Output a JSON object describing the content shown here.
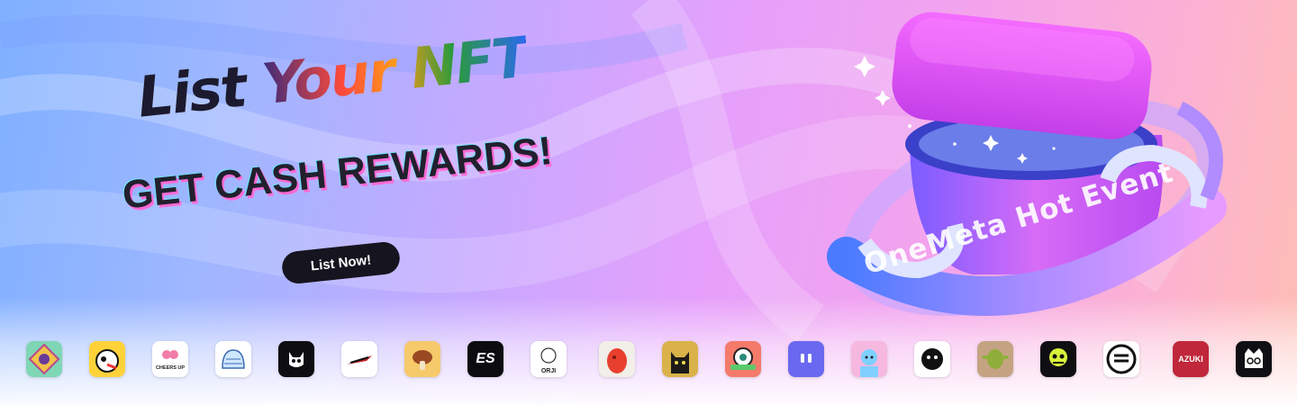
{
  "hero": {
    "title_part1": "List",
    "title_part2": "Your NFT",
    "subtitle": "GET CASH REWARDS!",
    "cta_label": "List Now!",
    "event_ribbon": "OneMeta Hot Event"
  },
  "logos": [
    {
      "name": "nft-logo-1"
    },
    {
      "name": "nft-logo-2"
    },
    {
      "name": "nft-logo-cheers-up",
      "text": "CHEERS UP"
    },
    {
      "name": "nft-logo-4"
    },
    {
      "name": "nft-logo-5"
    },
    {
      "name": "nft-logo-6"
    },
    {
      "name": "nft-logo-7"
    },
    {
      "name": "nft-logo-es",
      "text": "ES"
    },
    {
      "name": "nft-logo-orji",
      "text": "ORJI"
    },
    {
      "name": "nft-logo-10"
    },
    {
      "name": "nft-logo-11"
    },
    {
      "name": "nft-logo-12"
    },
    {
      "name": "nft-logo-13"
    },
    {
      "name": "nft-logo-14"
    },
    {
      "name": "nft-logo-15"
    },
    {
      "name": "nft-logo-16"
    },
    {
      "name": "nft-logo-17"
    },
    {
      "name": "nft-logo-18"
    },
    {
      "name": "nft-logo-azuki",
      "text": "AZUKI"
    },
    {
      "name": "nft-logo-20"
    }
  ],
  "colors": {
    "cta_bg": "#16141f",
    "box_magenta": "#e24cf2",
    "ribbon_blue": "#5a7cff"
  }
}
